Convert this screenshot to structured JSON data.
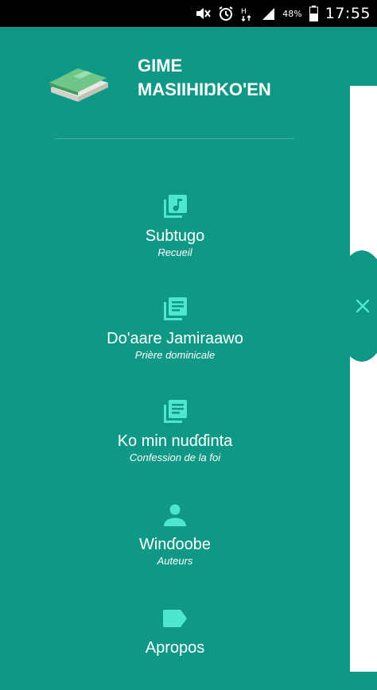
{
  "status_bar": {
    "battery_text": "48%",
    "time": "17:55",
    "icons": [
      "mute-icon",
      "alarm-icon",
      "network-h-icon",
      "signal-icon",
      "battery-icon"
    ]
  },
  "drawer": {
    "app_title_line1": "GIME",
    "app_title_line2": "MASIIHIŊKO'EN",
    "logo": "book-icon",
    "items": [
      {
        "label": "Subtugo",
        "sub": "Recueil",
        "icon": "music-library-icon"
      },
      {
        "label": "Do'aare Jamiraawo",
        "sub": "Prière dominicale",
        "icon": "document-library-icon"
      },
      {
        "label": "Ko min nuɗɗinta",
        "sub": "Confession de la foi",
        "icon": "document-library-icon"
      },
      {
        "label": "Winɗoobe",
        "sub": "Auteurs",
        "icon": "person-icon"
      },
      {
        "label": "Apropos",
        "sub": "",
        "icon": "label-tag-icon"
      }
    ]
  },
  "colors": {
    "drawer_bg": "#0f9886",
    "icon_accent": "#4ee6cf",
    "text": "#ffffff",
    "status_bar": "#000000"
  },
  "close_button": {
    "icon": "close-icon"
  }
}
